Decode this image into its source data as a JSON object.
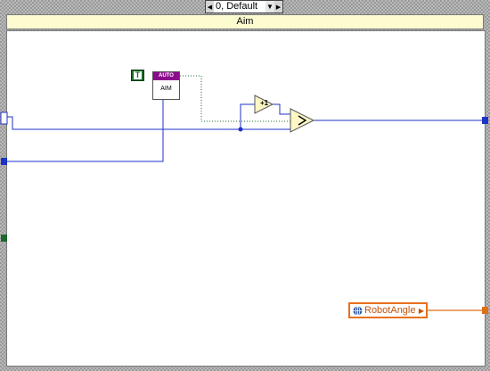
{
  "case_selector": {
    "value": "0, Default",
    "dec_icon": "left-triangle-icon",
    "inc_icon": "right-triangle-icon",
    "menu_icon": "dropdown-triangle-icon"
  },
  "frame": {
    "title": "Aim"
  },
  "nodes": {
    "true_constant": {
      "label": "T"
    },
    "aim_subvi": {
      "banner": "AUTO",
      "name": "AIM"
    },
    "increment": {
      "label": "+1"
    },
    "compare_icon": "greater-than-compare-icon",
    "local_variable": {
      "name": "RobotAngle",
      "icon": "globe-icon"
    }
  },
  "colors": {
    "wire_numeric": "#1e32c8",
    "wire_bool": "#1c6a2a",
    "wire_cluster": "#e06f14",
    "case_header": "#fdfbd0"
  }
}
